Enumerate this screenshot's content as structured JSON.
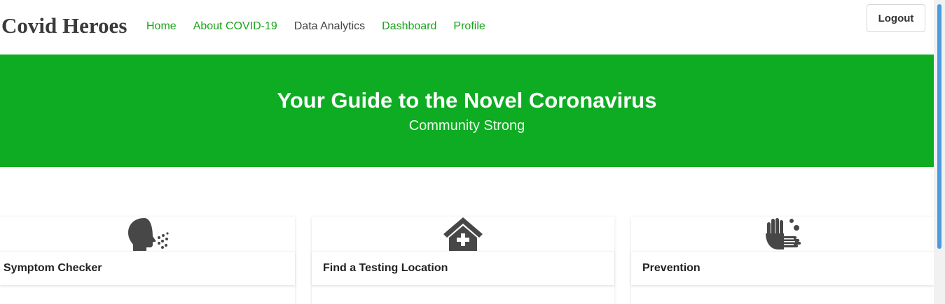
{
  "navbar": {
    "brand": "Covid Heroes",
    "links": [
      {
        "label": "Home",
        "active": false
      },
      {
        "label": "About COVID-19",
        "active": false
      },
      {
        "label": "Data Analytics",
        "active": true
      },
      {
        "label": "Dashboard",
        "active": false
      },
      {
        "label": "Profile",
        "active": false
      }
    ],
    "logout_label": "Logout"
  },
  "hero": {
    "title": "Your Guide to the Novel Coronavirus",
    "subtitle": "Community Strong"
  },
  "cards": [
    {
      "title": "Symptom Checker",
      "icon": "coughing-person-icon"
    },
    {
      "title": "Find a Testing Location",
      "icon": "clinic-icon"
    },
    {
      "title": "Prevention",
      "icon": "hand-washing-icon"
    }
  ],
  "colors": {
    "brand_green": "#0dac22",
    "link_green": "#1aa31a",
    "icon_gray": "#474747",
    "scroll_thumb": "#4a9be0"
  }
}
